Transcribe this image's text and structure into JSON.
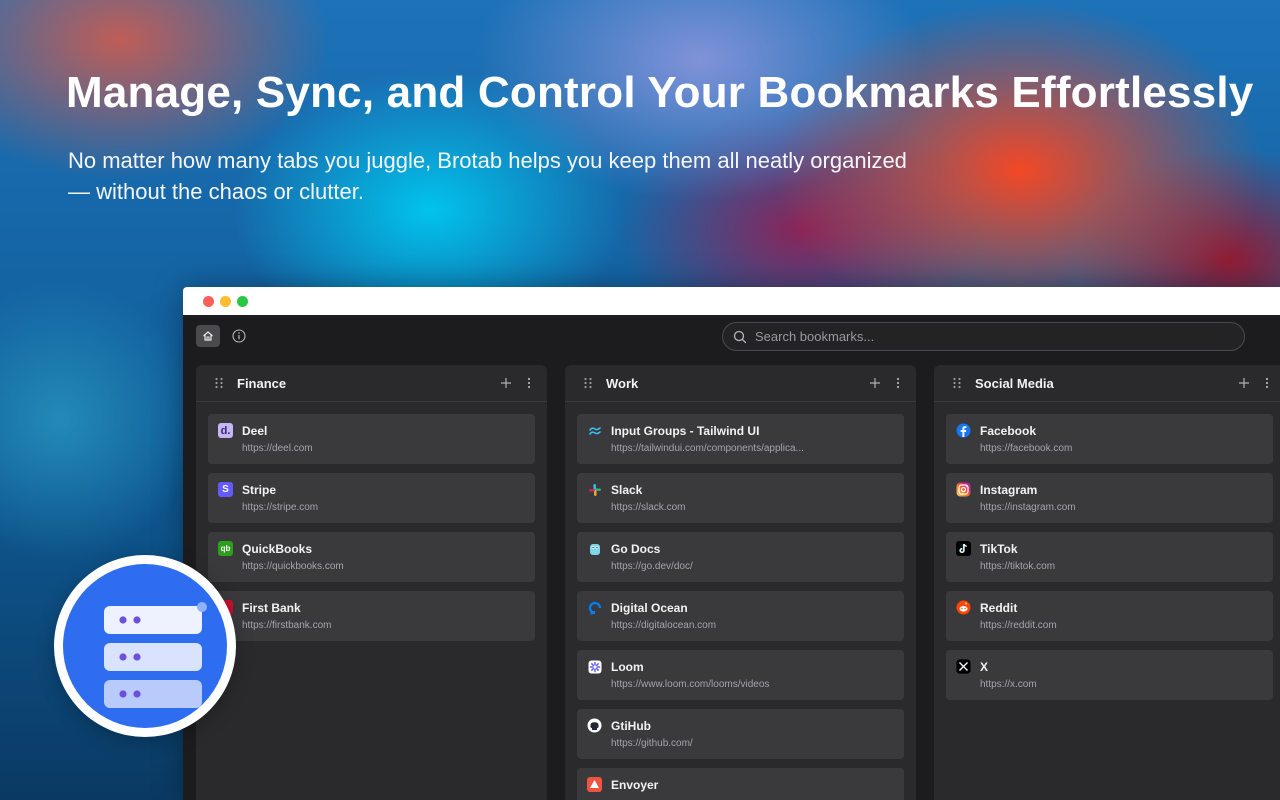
{
  "hero": {
    "title": "Manage, Sync, and Control Your Bookmarks Effortlessly",
    "subtitle_line1": "No matter how many tabs you juggle, Brotab helps you keep them all neatly organized",
    "subtitle_line2": "— without the chaos or clutter."
  },
  "toolbar": {
    "search_placeholder": "Search bookmarks..."
  },
  "columns": [
    {
      "title": "Finance",
      "items": [
        {
          "name": "Deel",
          "url": "https://deel.com",
          "icon": "deel-icon",
          "color": "#c7b6f5"
        },
        {
          "name": "Stripe",
          "url": "https://stripe.com",
          "icon": "stripe-icon",
          "color": "#635bff"
        },
        {
          "name": "QuickBooks",
          "url": "https://quickbooks.com",
          "icon": "quickbooks-icon",
          "color": "#2ca01c"
        },
        {
          "name": "First Bank",
          "url": "https://firstbank.com",
          "icon": "firstbank-icon",
          "color": "#c8102e"
        }
      ]
    },
    {
      "title": "Work",
      "items": [
        {
          "name": "Input Groups - Tailwind UI",
          "url": "https://tailwindui.com/components/applica...",
          "icon": "tailwind-icon",
          "color": "#38bdf8"
        },
        {
          "name": "Slack",
          "url": "https://slack.com",
          "icon": "slack-icon",
          "color": "#e01e5a"
        },
        {
          "name": "Go Docs",
          "url": "https://go.dev/doc/",
          "icon": "gopher-icon",
          "color": "#7fd5ea"
        },
        {
          "name": "Digital Ocean",
          "url": "https://digitalocean.com",
          "icon": "digitalocean-icon",
          "color": "#0080ff"
        },
        {
          "name": "Loom",
          "url": "https://www.loom.com/looms/videos",
          "icon": "loom-icon",
          "color": "#625df5"
        },
        {
          "name": "GtiHub",
          "url": "https://github.com/",
          "icon": "github-icon",
          "color": "#ffffff"
        },
        {
          "name": "Envoyer",
          "url": "",
          "icon": "envoyer-icon",
          "color": "#f05340"
        }
      ]
    },
    {
      "title": "Social Media",
      "items": [
        {
          "name": "Facebook",
          "url": "https://facebook.com",
          "icon": "facebook-icon",
          "color": "#1877f2"
        },
        {
          "name": "Instagram",
          "url": "https://instagram.com",
          "icon": "instagram-icon",
          "color": "#e1306c"
        },
        {
          "name": "TikTok",
          "url": "https://tiktok.com",
          "icon": "tiktok-icon",
          "color": "#000000"
        },
        {
          "name": "Reddit",
          "url": "https://reddit.com",
          "icon": "reddit-icon",
          "color": "#ff4500"
        },
        {
          "name": "X",
          "url": "https://x.com",
          "icon": "x-icon",
          "color": "#000000"
        }
      ]
    }
  ]
}
